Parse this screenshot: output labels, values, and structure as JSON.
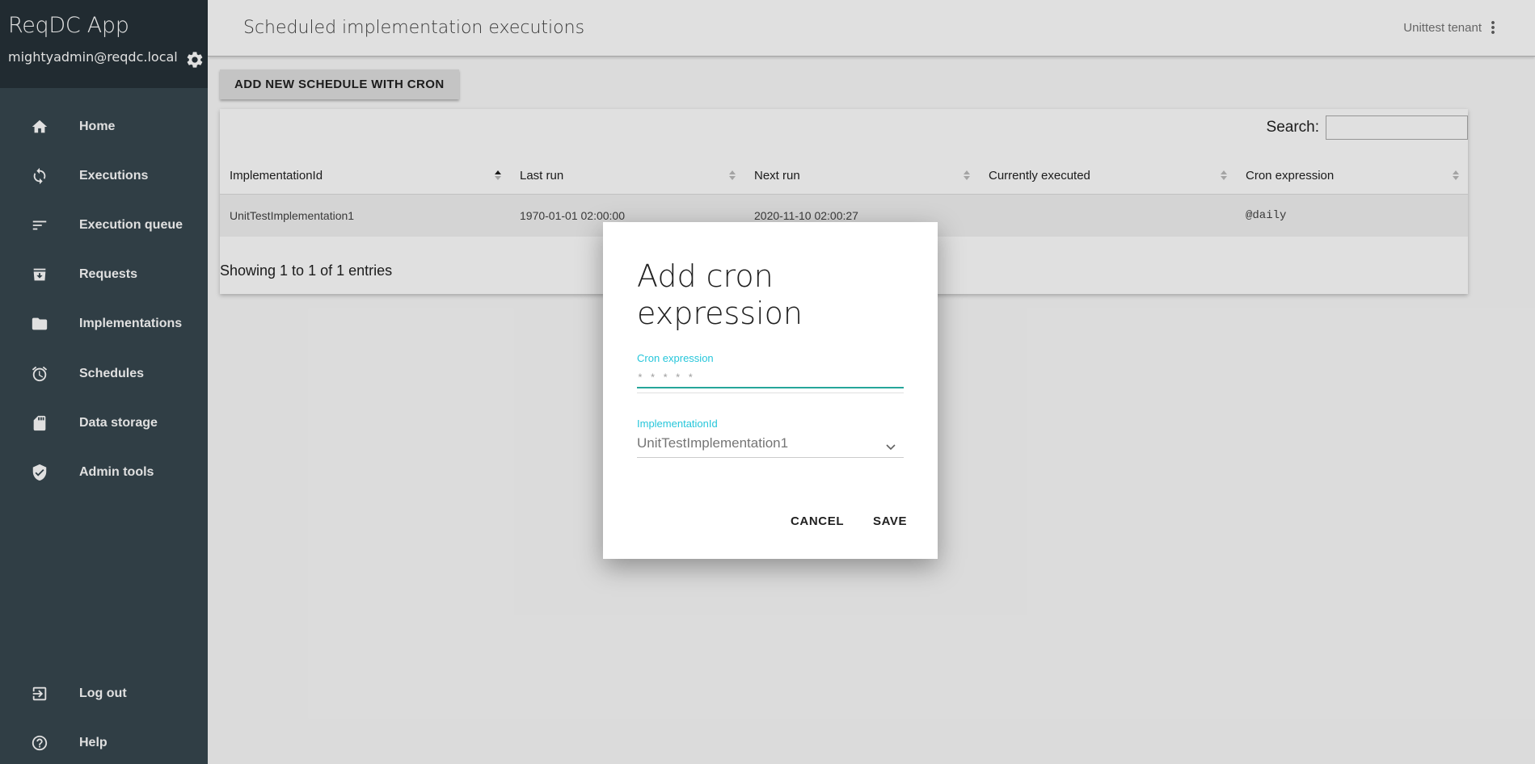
{
  "sidebar": {
    "app_title": "ReqDC App",
    "user_email": "mightyadmin@reqdc.local",
    "items": [
      {
        "label": "Home",
        "icon": "home-icon"
      },
      {
        "label": "Executions",
        "icon": "sync-icon"
      },
      {
        "label": "Execution queue",
        "icon": "sort-lines-icon"
      },
      {
        "label": "Requests",
        "icon": "inbox-icon"
      },
      {
        "label": "Implementations",
        "icon": "folder-icon"
      },
      {
        "label": "Schedules",
        "icon": "alarm-icon"
      },
      {
        "label": "Data storage",
        "icon": "sd-card-icon"
      },
      {
        "label": "Admin tools",
        "icon": "shield-check-icon"
      }
    ],
    "bottom_items": [
      {
        "label": "Log out",
        "icon": "exit-icon"
      },
      {
        "label": "Help",
        "icon": "help-circle-icon"
      }
    ]
  },
  "header": {
    "title": "Scheduled implementation executions",
    "tenant": "Unittest tenant"
  },
  "toolbar": {
    "add_label": "ADD NEW SCHEDULE WITH CRON"
  },
  "table": {
    "search_label": "Search:",
    "columns": [
      "ImplementationId",
      "Last run",
      "Next run",
      "Currently executed",
      "Cron expression"
    ],
    "rows": [
      [
        "UnitTestImplementation1",
        "1970-01-01 02:00:00",
        "2020-11-10 02:00:27",
        "",
        "@daily"
      ]
    ],
    "info": "Showing 1 to 1 of 1 entries"
  },
  "dialog": {
    "title": "Add cron expression",
    "cron_label": "Cron expression",
    "cron_value": "* * * * *",
    "impl_label": "ImplementationId",
    "impl_value": "UnitTestImplementation1",
    "cancel_label": "CANCEL",
    "save_label": "SAVE"
  },
  "colors": {
    "sidebar_bg": "#37474f",
    "sidebar_header_bg": "#263238",
    "accent": "#26c6da",
    "input_underline": "#26a69a"
  }
}
